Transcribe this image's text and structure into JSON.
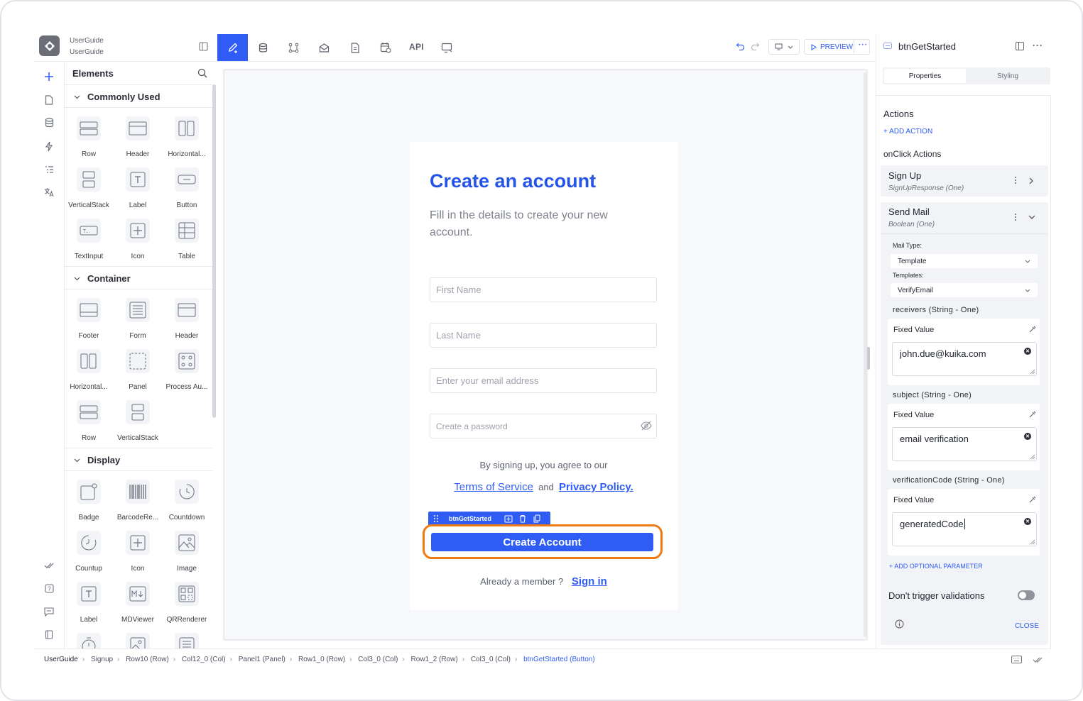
{
  "app": {
    "project_line1": "UserGuide",
    "project_line2": "UserGuide"
  },
  "toolbar": {
    "api_label": "API",
    "preview_label": "PREVIEW",
    "icons": [
      "pencil-icon",
      "database-icon",
      "flow-icon",
      "mail-icon",
      "document-icon",
      "calendar-icon",
      "monitor-icon"
    ]
  },
  "elements_panel": {
    "title": "Elements",
    "sections": [
      {
        "title": "Commonly Used",
        "items": [
          "Row",
          "Header",
          "Horizontal...",
          "VerticalStack",
          "Label",
          "Button",
          "TextInput",
          "Icon",
          "Table"
        ]
      },
      {
        "title": "Container",
        "items": [
          "Footer",
          "Form",
          "Header",
          "Horizontal...",
          "Panel",
          "Process Au...",
          "Row",
          "VerticalStack"
        ]
      },
      {
        "title": "Display",
        "items": [
          "Badge",
          "BarcodeRe...",
          "Countdown",
          "Countup",
          "Icon",
          "Image",
          "Label",
          "MDViewer",
          "QRRenderer"
        ]
      }
    ]
  },
  "form": {
    "title": "Create an account",
    "subtitle_line1": "Fill in the details to create your new",
    "subtitle_line2": "account.",
    "first_name_placeholder": "First Name",
    "last_name_placeholder": "Last Name",
    "email_placeholder": "Enter your email address",
    "password_placeholder": "Create a password",
    "agree_text": "By signing up, you agree to our",
    "terms_link": "Terms of Service",
    "and_text": "and",
    "privacy_link": "Privacy Policy.",
    "selection_tag": "btnGetStarted",
    "create_button": "Create Account",
    "member_text": "Already a member ?",
    "signin_link": "Sign in"
  },
  "inspector": {
    "component_name": "btnGetStarted",
    "tabs": [
      "Properties",
      "Styling"
    ],
    "actions_heading": "Actions",
    "add_action": "+ ADD ACTION",
    "onclick_heading": "onClick Actions",
    "actions": [
      {
        "title": "Sign Up",
        "subtitle": "SignUpResponse (One)"
      },
      {
        "title": "Send Mail",
        "subtitle": "Boolean (One)"
      }
    ],
    "mail_type_label": "Mail Type:",
    "mail_type_value": "Template",
    "templates_label": "Templates:",
    "templates_value": "VerifyEmail",
    "params": [
      {
        "label": "receivers (String - One)",
        "mode": "Fixed Value",
        "value": "john.due@kuika.com"
      },
      {
        "label": "subject (String - One)",
        "mode": "Fixed Value",
        "value": "email verification"
      },
      {
        "label": "verificationCode (String - One)",
        "mode": "Fixed Value",
        "value": "generatedCode"
      }
    ],
    "add_optional": "+ ADD OPTIONAL PARAMETER",
    "dont_trigger": "Don't trigger validations",
    "toggle_on": false,
    "close_label": "CLOSE"
  },
  "breadcrumb": [
    "UserGuide",
    "Signup",
    "Row10 (Row)",
    "Col12_0 (Col)",
    "Panel1 (Panel)",
    "Row1_0 (Row)",
    "Col3_0 (Col)",
    "Row1_2 (Row)",
    "Col3_0 (Col)",
    "btnGetStarted (Button)"
  ],
  "colors": {
    "accent": "#2f5cf5",
    "highlight": "#f07a12",
    "title_blue": "#2554e8"
  }
}
